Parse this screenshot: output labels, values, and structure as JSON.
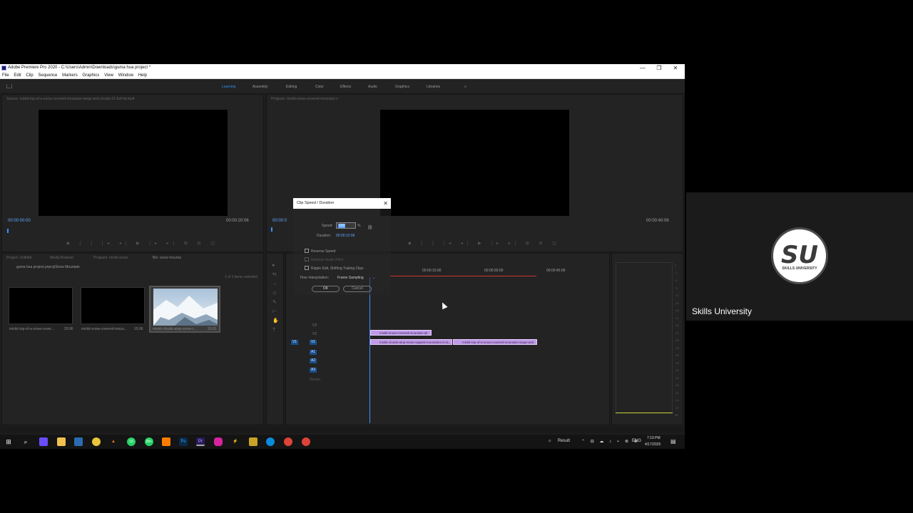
{
  "window": {
    "title": "Adobe Premiere Pro 2020 - C:\\Users\\Admin\\Downloads\\guma hua project *",
    "minimize": "—",
    "maximize": "❐",
    "close": "✕"
  },
  "menu": [
    "File",
    "Edit",
    "Clip",
    "Sequence",
    "Markers",
    "Graphics",
    "View",
    "Window",
    "Help"
  ],
  "workspaces": {
    "items": [
      "Learning",
      "Assembly",
      "Editing",
      "Color",
      "Effects",
      "Audio",
      "Graphics",
      "Libraries"
    ],
    "active": "Learning",
    "more": "»"
  },
  "source_monitor": {
    "title": "Source: mixkit-top-of-a-snow-covered-mountain-range-and-clouds-21-full-hd.mp4",
    "timecode_left": "00:00:00:00",
    "timecode_right": "00:00:20:06"
  },
  "program_monitor": {
    "title": "Program: mixkit-snow-covered-mountain ≡",
    "timecode_left": "00:00:0",
    "timecode_right": "00:00:40:06"
  },
  "project_panel": {
    "tabs": [
      "Project: Untitled",
      "Media Browser",
      "Program: mixkit-snow",
      "Bin: snow mounta"
    ],
    "path": "guma hua project.prproj\\Snow Mountain",
    "count": "1 of 3 items selected",
    "items": [
      {
        "name": "mixkit-top-of-a-snow-cover...",
        "duration": "20:06"
      },
      {
        "name": "mixkit-snow-covered-moun...",
        "duration": "15:06"
      },
      {
        "name": "mixkit-clouds-atop-snow-c...",
        "duration": "20:01"
      }
    ]
  },
  "timeline": {
    "ruler": [
      "00:00:15:00",
      "00:00:30:00",
      "00:00:45:00"
    ],
    "tracks": [
      "V3",
      "V2",
      "V1",
      "A1",
      "A2",
      "A3"
    ],
    "clips": {
      "v2": "mixkit-snow-covered-mountain-ab",
      "v1_a": "mixkit-clouds-atop-snow-capped-mountains-d-11...",
      "v1_b": "mixkit-top-of-a-snow-covered-mountain-range-and"
    },
    "source_patch": "V1",
    "master": "Master"
  },
  "dialog": {
    "title": "Clip Speed / Duration",
    "close": "✕",
    "speed_label": "Speed:",
    "speed_value": "100",
    "speed_unit": "%",
    "duration_label": "Duration:",
    "duration_value": "00:00:12:06",
    "reverse_speed": "Reverse Speed",
    "maintain_audio": "Maintain Audio Pitch",
    "ripple_edit": "Ripple Edit, Shifting Trailing Clips",
    "time_interp_label": "Time Interpolation:",
    "time_interp_value": "Frame Sampling",
    "ok": "OK",
    "cancel": "Cancel"
  },
  "meter_scale": [
    "0",
    "-3",
    "-6",
    "-9",
    "-12",
    "-15",
    "-18",
    "-21",
    "-24",
    "-27",
    "-30",
    "-33",
    "-36",
    "-39",
    "-42",
    "-45",
    "-48",
    "-51",
    "-54",
    "-57",
    "dB"
  ],
  "webcam": {
    "logo": "SU",
    "logo_sub": "SKILLS UNIVERSITY",
    "name": "Skills University"
  },
  "taskbar": {
    "weather": "Result",
    "lang": "ENG",
    "time": "7:19 PM",
    "date": "4/17/2025",
    "badge_1": "16",
    "badge_2": "99+"
  },
  "colors": {
    "accent": "#2d8ceb",
    "clip_purple": "#c09ae8",
    "panel": "#232323"
  }
}
